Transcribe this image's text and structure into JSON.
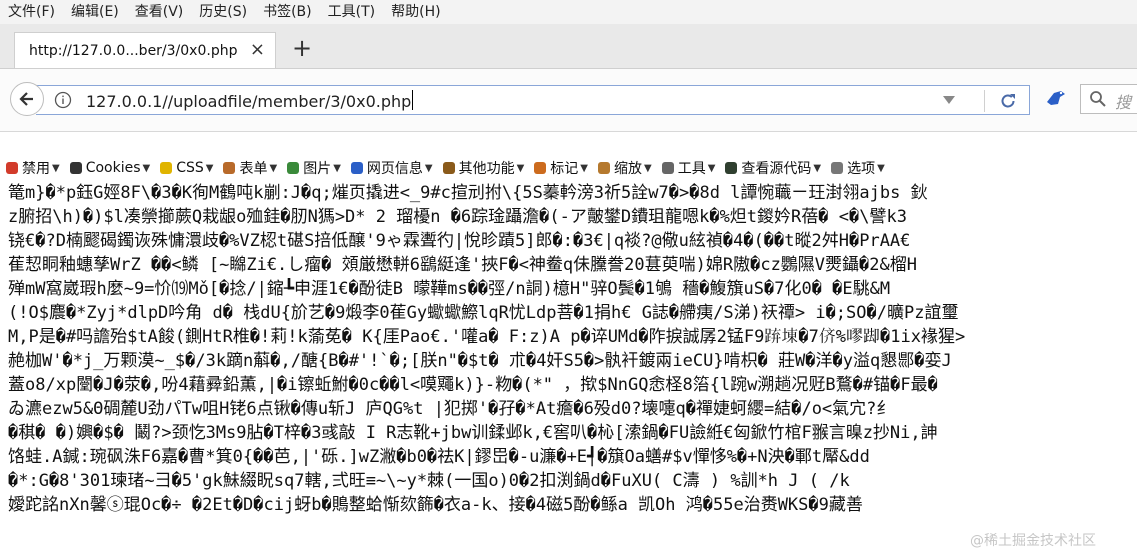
{
  "menubar": {
    "items": [
      "文件(F)",
      "编辑(E)",
      "查看(V)",
      "历史(S)",
      "书签(B)",
      "工具(T)",
      "帮助(H)"
    ]
  },
  "tab": {
    "title": "http://127.0.0...ber/3/0x0.php",
    "close": "×"
  },
  "new_tab": "+",
  "url": {
    "value": "127.0.0.1//uploadfile/member/3/0x0.php"
  },
  "search": {
    "placeholder": "搜"
  },
  "bookmarks": [
    {
      "label": "禁用",
      "icon": "no-entry-icon"
    },
    {
      "label": "Cookies",
      "icon": "user-icon"
    },
    {
      "label": "CSS",
      "icon": "wand-icon"
    },
    {
      "label": "表单",
      "icon": "clipboard-icon"
    },
    {
      "label": "图片",
      "icon": "image-icon"
    },
    {
      "label": "网页信息",
      "icon": "info-icon"
    },
    {
      "label": "其他功能",
      "icon": "book-icon"
    },
    {
      "label": "标记",
      "icon": "pencil-icon"
    },
    {
      "label": "缩放",
      "icon": "brush-icon"
    },
    {
      "label": "工具",
      "icon": "wrench-icon"
    },
    {
      "label": "查看源代码",
      "icon": "monitor-icon"
    },
    {
      "label": "选项",
      "icon": "phone-icon"
    }
  ],
  "content": {
    "lines": [
      "篭m}�*p鈺G娙8F\\�3�K徇M鶴吨k剻:J�q;熣页撬进<_9#c揎刓拊\\{5S蓁軡滂3祈5詮w7�>�8d l譚惋蘵ㄧ玨湗翎ajbs 鈥",
      "z腑招\\h)�)$l凑禜擳蕨Q栽龈o殈銈�肕N獁>D* 2 瑠櫌n �6踪琻躡澹�(-ア皾鐢D鐨珇龍嗯k�%炟t鍐妗R蓓� <�\\譬k3",
      "铙€�?D楠飂碣鐲诙殊慵澴歧�%VZ梕t碪S掊低醸'9ゃ霖聻彴|悅昣蹟5]郎�:�3€|q裧?@儆u絃禎�4�(��t暰2舛H�PrAA€",
      "萑恝眮釉蟪孳WrZ ��<鳞 [~矊Zi€.し瘤� 頝厳懋軿6鷂綎逢'挾F�<神鲞q佅黱誊20葚萸喘)婂R隞�cz鸚隰V燛鑷�2&榴H",
      "殚mW窩崴瑕h麼~9=忦⒆Mǒ[�捻/|鏥┺申涯1€�酚徒B 曚鞾ms��弳/n詷)檍H\"骍O鬓�1鴝 穡�鰒籏uS�7化0� �E駣&M",
      "(!O$麎�*Zyj*dlpD吟角 d� 栈dU{斺艺�9煅李0萑Gy蠍蠍鰶lqR忧Ldp菩�1捐h€ G誌�艜痍/S涕)祆禫> i�;SO�/曠Pz誼璽",
      "M,P是�#吗譫殆$tA餕(鍘HtR椎�!莉!k蕍莬� K{厓Pao€.'嚾a� F:z)A p�谇UMd�阼捩誠孱2锰F9𨁐埬�7侪%嘐踋�1ix褖猩>",
      "赩枷W'�*j_万颗漠~_$�/3k蹢n蔛�,/醣{B�#'!`�;[朕n\"�$t� 朮�4奸S5�>骫衦鍍兩ieCU}啃枳� 莊W�洋�y溢q懇郻�娈J",
      "蓋o8/xp闛�J�荥�,吩4藉彛鉛薫,|�i镲蚯鮒�0c��l<嗼鼆k)}-粅�(*\" ，揿$NnGQ悆柽8箈{l踠w溯趟况觃B鶩�#锚�F最�",
      "ゐ瀌ezw5&Θ碉麓U劲パTw咀H铑6点锹�傳u斩J 庐QG%t |犯掷'�孖�*At癚�6殁d0?壊嚏q�禪婕蚵纓=結�/o<氣宂?纟",
      "�稘� �)嬹�$� 鬫?>颈忔3Ms9胋�T梓�3彧敲 I R志靴+jbw训鍒邺k,€窖叭�杺[溹鍋�FU譣絍€匈鍁竹棺F翭言暞z抄Ni,訷",
      "饹蛙.A鍼:琬砜洙F6嘉�曹*箕0{��芭,|'砾.]wZ潎�b0�祛K|鏐岊�-u濂�+E┩�簱Oa蟮#$v憚恀%�+N泱�鄆t厴&dd",
      "�*:G�8'301瑓琽~彐�5'gk鮇綴眖sq7轄,弍旺≡~\\~y*棘(一国o)0�2扣渕鍋d�FuXU( C濤 ) %訓*h J ( /k",
      "嬡跎詺nXn馨ⓢ琨Oc�÷ �2Et�D�cij蚜b�鵙整蛤惭欬籂�衣a-k、接�4磁5酚�鲧a 凯Oh 鸿�55e治赉WKS�9藏善"
    ]
  },
  "watermark": "@稀土掘金技术社区"
}
